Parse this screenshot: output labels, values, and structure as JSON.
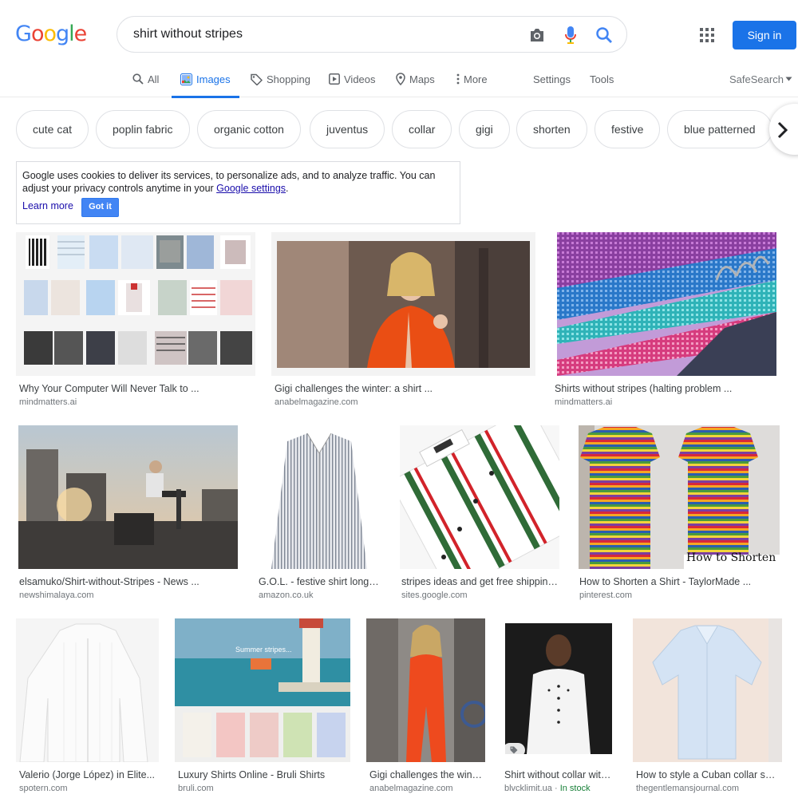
{
  "header": {
    "logo_letters": [
      "G",
      "o",
      "o",
      "g",
      "l",
      "e"
    ],
    "search": {
      "value": "shirt without stripes"
    },
    "camera_icon": "camera-icon",
    "mic_icon": "microphone-icon",
    "search_icon": "search-icon",
    "apps_icon": "apps-grid-icon",
    "signin_label": "Sign in"
  },
  "tabs": {
    "items": [
      {
        "label": "All",
        "icon": "search-icon"
      },
      {
        "label": "Images",
        "icon": "image-icon",
        "active": true
      },
      {
        "label": "Shopping",
        "icon": "tag-icon"
      },
      {
        "label": "Videos",
        "icon": "play-icon"
      },
      {
        "label": "Maps",
        "icon": "map-pin-icon"
      },
      {
        "label": "More",
        "icon": "more-vert-icon"
      }
    ],
    "settings": "Settings",
    "tools": "Tools",
    "safesearch": "SafeSearch"
  },
  "chips": [
    "cute cat",
    "poplin fabric",
    "organic cotton",
    "juventus",
    "collar",
    "gigi",
    "shorten",
    "festive",
    "blue patterned"
  ],
  "cookie": {
    "text_before": "Google uses cookies to deliver its services, to personalize ads, and to analyze traffic. You can adjust your privacy controls anytime in your ",
    "link": "Google settings",
    "text_after": ".",
    "learn_more": "Learn more",
    "got_it": "Got it"
  },
  "results": [
    {
      "title": "Why Your Computer Will Never Talk to ...",
      "source": "mindmatters.ai"
    },
    {
      "title": "Gigi challenges the winter: a shirt ...",
      "source": "anabelmagazine.com"
    },
    {
      "title": "Shirts without stripes (halting problem ...",
      "source": "mindmatters.ai"
    },
    {
      "title": "elsamuko/Shirt-without-Stripes - News ...",
      "source": "newshimalaya.com"
    },
    {
      "title": "G.O.L. - festive shirt long sleeve...",
      "source": "amazon.co.uk"
    },
    {
      "title": "stripes ideas and get free shipping...",
      "source": "sites.google.com"
    },
    {
      "title": "How to Shorten a Shirt - TaylorMade ...",
      "source": "pinterest.com",
      "overlay": "How to Shorten"
    },
    {
      "title": "Valerio (Jorge López) in Elite...",
      "source": "spotern.com"
    },
    {
      "title": "Luxury Shirts Online - Bruli Shirts",
      "source": "bruli.com",
      "overlay": "Summer stripes..."
    },
    {
      "title": "Gigi challenges the winter...",
      "source": "anabelmagazine.com"
    },
    {
      "title": "Shirt without collar with...",
      "source": "blvcklimit.ua",
      "stock": "In stock"
    },
    {
      "title": "How to style a Cuban collar shirt...",
      "source": "thegentlemansjournal.com"
    }
  ],
  "colors": {
    "accent": "#1a73e8",
    "chip_border": "#dfe1e5",
    "source_text": "#70757a",
    "in_stock": "#188038"
  }
}
